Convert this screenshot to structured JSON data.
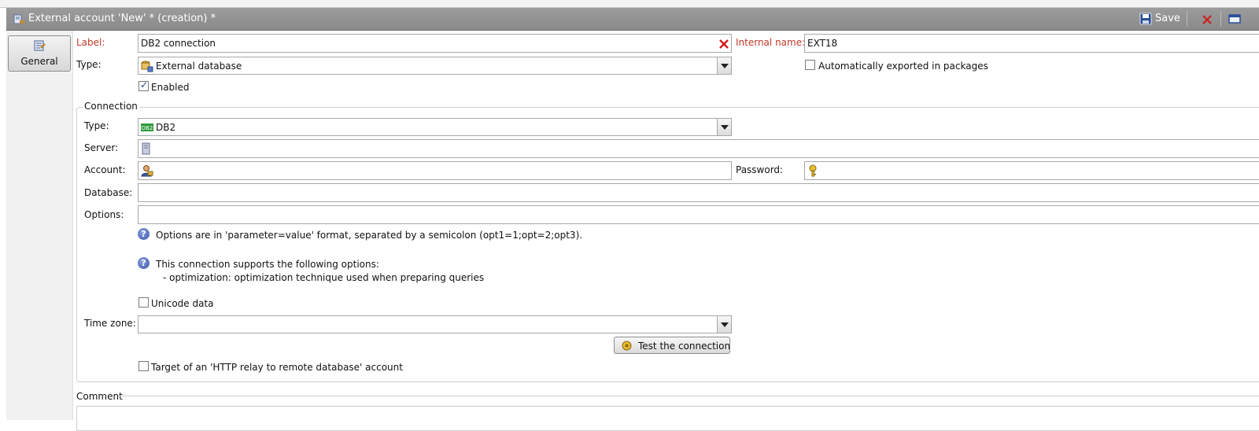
{
  "window": {
    "title": "External account 'New' * (creation) *"
  },
  "toolbar": {
    "save_label": "Save"
  },
  "tabs": {
    "general_label": "General"
  },
  "form": {
    "label_caption": "Label:",
    "label_value": "DB2 connection",
    "internal_name_caption": "Internal name:",
    "internal_name_value": "EXT18",
    "type_caption": "Type:",
    "type_value": "External database",
    "auto_export_label": "Automatically exported in packages",
    "enabled_label": "Enabled"
  },
  "connection": {
    "group_title": "Connection",
    "type_caption": "Type:",
    "type_value": "DB2",
    "server_caption": "Server:",
    "server_value": "",
    "account_caption": "Account:",
    "account_value": "",
    "password_caption": "Password:",
    "password_value": "",
    "database_caption": "Database:",
    "database_value": "",
    "options_caption": "Options:",
    "options_value": "",
    "help_options_format": "Options are in 'parameter=value' format, separated by a semicolon (opt1=1;opt=2;opt3).",
    "help_supported_title": "This connection supports the following options:",
    "help_supported_item": "- optimization: optimization technique used when preparing queries",
    "unicode_label": "Unicode data",
    "timezone_caption": "Time zone:",
    "timezone_value": "",
    "test_button_label": "Test the connection",
    "http_relay_label": "Target of an 'HTTP relay to remote database' account"
  },
  "comment": {
    "title": "Comment"
  },
  "colors": {
    "titlebar": "#8f8f8f",
    "required_label": "#c0392b",
    "help_icon": "#3a56a8",
    "clear_icon": "#d11a1a",
    "db2_badge": "#2e9b3a"
  },
  "icons": [
    "external-account-icon",
    "save-icon",
    "close-icon",
    "window-icon",
    "general-tab-icon",
    "clear-field-icon",
    "database-type-icon",
    "db2-badge-icon",
    "server-icon",
    "account-icon",
    "key-icon",
    "help-icon",
    "test-connection-icon",
    "chevron-down-icon"
  ]
}
